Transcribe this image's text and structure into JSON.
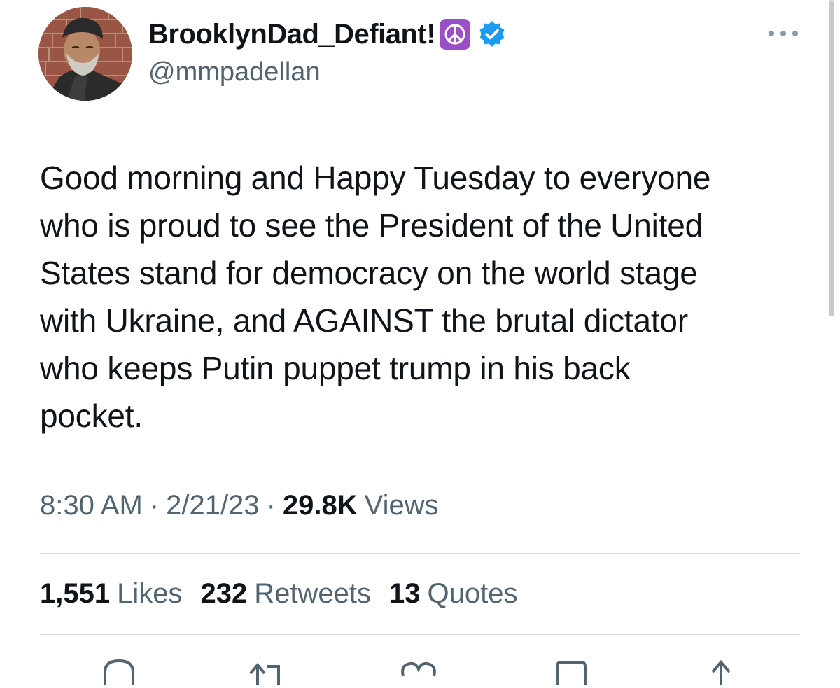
{
  "author": {
    "display_name": "BrooklynDad_Defiant!",
    "handle": "@mmpadellan",
    "badge_icon": "peace-symbol-icon",
    "verified_icon": "verified-badge-icon",
    "verified_color": "#1d9bf0"
  },
  "tweet": {
    "text": "Good morning and Happy Tuesday to everyone\nwho is proud to see the President of the United\nStates stand for democracy on the world stage\nwith Ukraine, and AGAINST the brutal dictator\nwho keeps Putin puppet trump in his back\npocket."
  },
  "meta": {
    "time": "8:30 AM",
    "separator": "·",
    "date": "2/21/23",
    "views_count": "29.8K",
    "views_label": "Views"
  },
  "stats": {
    "likes_count": "1,551",
    "likes_label": "Likes",
    "retweets_count": "232",
    "retweets_label": "Retweets",
    "quotes_count": "13",
    "quotes_label": "Quotes"
  },
  "colors": {
    "text_primary": "#0f1419",
    "text_secondary": "#536471",
    "divider": "#d9dfe3",
    "peace_badge": "#9b4fc7"
  }
}
